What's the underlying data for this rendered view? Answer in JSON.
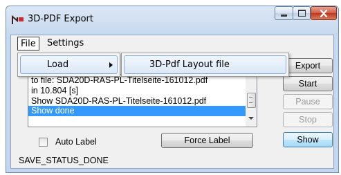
{
  "window": {
    "title": "3D-PDF Export",
    "controls": {
      "minimize": "minimize-icon",
      "maximize": "maximize-icon",
      "close": "close-icon"
    }
  },
  "menubar": {
    "file": "File",
    "settings": "Settings"
  },
  "file_menu": {
    "load": "Load",
    "submenu_arrow": "▸"
  },
  "load_submenu": {
    "layout_file": "3D-Pdf Layout file"
  },
  "log": {
    "lines": [
      "to file: SDA20D-RAS-PL-Titelseite-161012.pdf",
      "  in 10.804 [s]",
      "Show  SDA20D-RAS-PL-Titelseite-161012.pdf",
      "Show  done"
    ],
    "selected_index": 3
  },
  "buttons": {
    "export": "Export",
    "start": "Start",
    "pause": "Pause",
    "stop": "Stop",
    "show": "Show",
    "force_label": "Force Label"
  },
  "auto_label": {
    "label": "Auto Label",
    "checked": false
  },
  "status": "SAVE_STATUS_DONE",
  "colors": {
    "selection": "#3399ff",
    "close_button": "#c0391f",
    "title_bar": "#c8d9ee"
  }
}
